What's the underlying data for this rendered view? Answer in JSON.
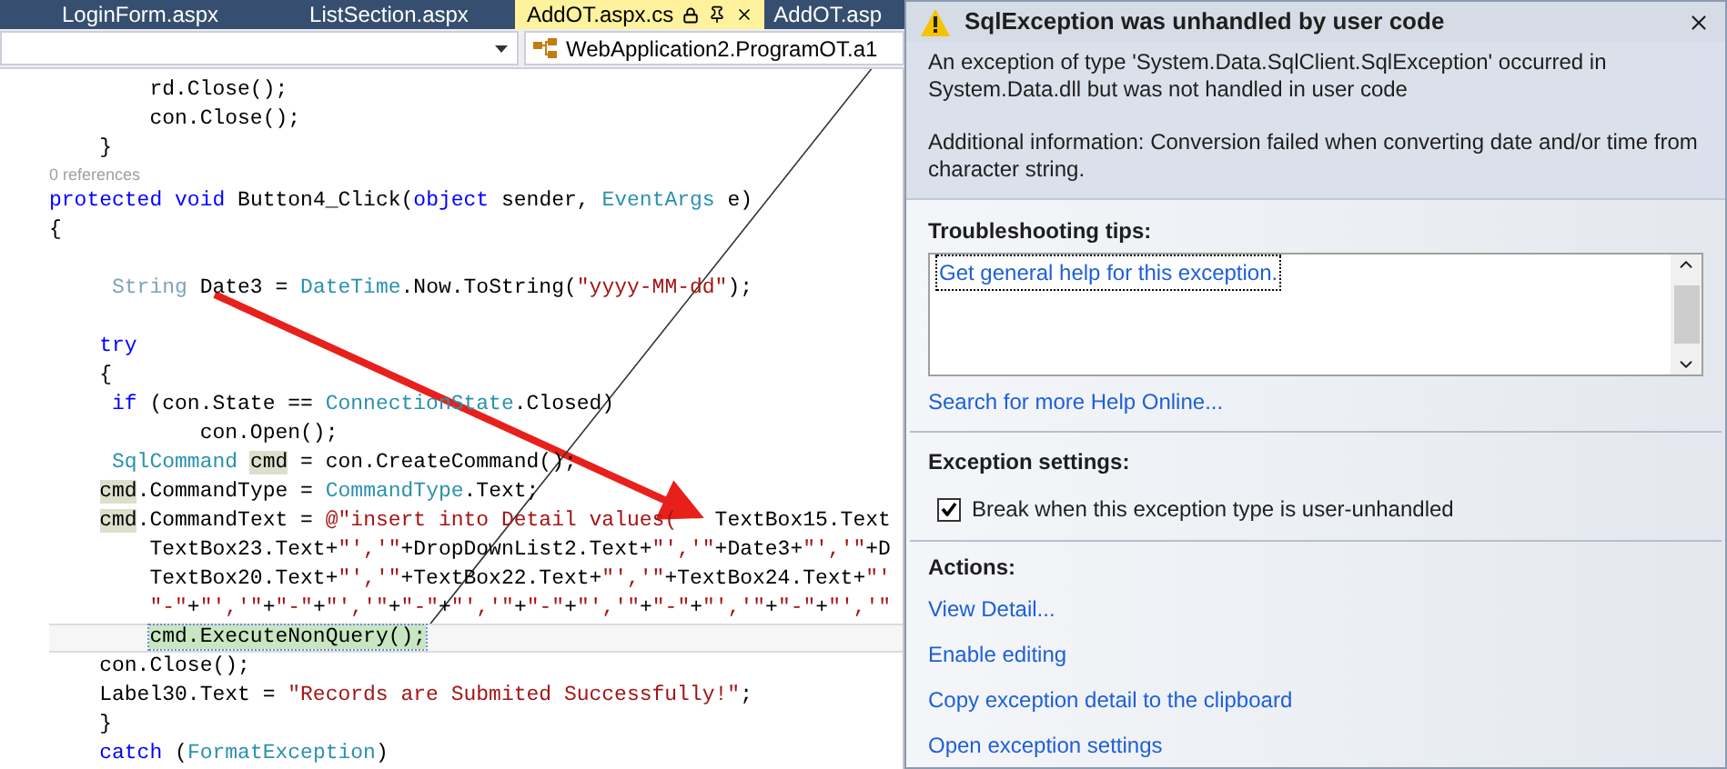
{
  "tabs": [
    {
      "label": "LoginForm.aspx",
      "selected": false
    },
    {
      "label": "ListSection.aspx",
      "selected": false
    },
    {
      "label": "AddOT.aspx.cs",
      "selected": true
    },
    {
      "label": "AddOT.asp",
      "selected": false
    }
  ],
  "nav_bar": {
    "class_dropdown": "WebApplication2.ProgramOT.a1"
  },
  "code_lines": [
    {
      "tokens": [
        {
          "kind": "plain",
          "text": "        rd.Close();"
        }
      ]
    },
    {
      "tokens": [
        {
          "kind": "plain",
          "text": "        con.Close();"
        }
      ]
    },
    {
      "tokens": [
        {
          "kind": "plain",
          "text": "    }"
        }
      ]
    },
    {
      "tokens": [
        {
          "kind": "ref",
          "text": "0 references"
        }
      ]
    },
    {
      "tokens": [
        {
          "kind": "kw",
          "text": "protected"
        },
        {
          "kind": "kw",
          "text": " void"
        },
        {
          "kind": "plain",
          "text": " Button4_Click("
        },
        {
          "kind": "kw",
          "text": "object"
        },
        {
          "kind": "plain",
          "text": " sender, "
        },
        {
          "kind": "type",
          "text": "EventArgs"
        },
        {
          "kind": "plain",
          "text": " e)"
        }
      ]
    },
    {
      "tokens": [
        {
          "kind": "plain",
          "text": "{"
        }
      ]
    },
    {
      "blank": true
    },
    {
      "tokens": [
        {
          "kind": "faded",
          "text": "     String"
        },
        {
          "kind": "plain",
          "text": " Date3 = "
        },
        {
          "kind": "type",
          "text": "DateTime"
        },
        {
          "kind": "plain",
          "text": ".Now.ToString("
        },
        {
          "kind": "str",
          "text": "\"yyyy-MM-dd\""
        },
        {
          "kind": "plain",
          "text": ");"
        }
      ]
    },
    {
      "blank": true
    },
    {
      "tokens": [
        {
          "kind": "kw",
          "text": "    try"
        }
      ]
    },
    {
      "tokens": [
        {
          "kind": "plain",
          "text": "    {"
        }
      ]
    },
    {
      "tokens": [
        {
          "kind": "kw",
          "text": "     if"
        },
        {
          "kind": "plain",
          "text": " (con.State == "
        },
        {
          "kind": "type",
          "text": "ConnectionState"
        },
        {
          "kind": "plain",
          "text": ".Closed)"
        }
      ]
    },
    {
      "tokens": [
        {
          "kind": "plain",
          "text": "            con.Open();"
        }
      ]
    },
    {
      "tokens": [
        {
          "kind": "type",
          "text": "     SqlCommand"
        },
        {
          "kind": "ref_highlight",
          "text": " cmd"
        },
        {
          "kind": "plain",
          "text": " = con.CreateCommand();"
        }
      ]
    },
    {
      "tokens": [
        {
          "kind": "ref_highlight",
          "text": "    cmd"
        },
        {
          "kind": "plain",
          "text": ".CommandType = "
        },
        {
          "kind": "type",
          "text": "CommandType"
        },
        {
          "kind": "plain",
          "text": ".Text;"
        }
      ]
    },
    {
      "tokens": [
        {
          "kind": "ref_highlight",
          "text": "    cmd"
        },
        {
          "kind": "plain",
          "text": ".CommandText = "
        },
        {
          "kind": "str",
          "text": "@\"insert into Detail values("
        },
        {
          "kind": "plain",
          "text": "   TextBox15.Text"
        }
      ]
    },
    {
      "tokens": [
        {
          "kind": "plain",
          "text": "        TextBox23.Text+"
        },
        {
          "kind": "str",
          "text": "\"','\""
        },
        {
          "kind": "plain",
          "text": "+DropDownList2.Text+"
        },
        {
          "kind": "str",
          "text": "\"','\""
        },
        {
          "kind": "plain",
          "text": "+Date3+"
        },
        {
          "kind": "str",
          "text": "\"','\""
        },
        {
          "kind": "plain",
          "text": "+D"
        }
      ]
    },
    {
      "tokens": [
        {
          "kind": "plain",
          "text": "        TextBox20.Text+"
        },
        {
          "kind": "str",
          "text": "\"','\""
        },
        {
          "kind": "plain",
          "text": "+TextBox22.Text+"
        },
        {
          "kind": "str",
          "text": "\"','\""
        },
        {
          "kind": "plain",
          "text": "+TextBox24.Text+"
        },
        {
          "kind": "str",
          "text": "\"'"
        }
      ]
    },
    {
      "tokens": [
        {
          "kind": "str",
          "text": "        \"-\""
        },
        {
          "kind": "plain",
          "text": "+"
        },
        {
          "kind": "str",
          "text": "\"','\""
        },
        {
          "kind": "plain",
          "text": "+"
        },
        {
          "kind": "str",
          "text": "\"-\""
        },
        {
          "kind": "plain",
          "text": "+"
        },
        {
          "kind": "str",
          "text": "\"','\""
        },
        {
          "kind": "plain",
          "text": "+"
        },
        {
          "kind": "str",
          "text": "\"-\""
        },
        {
          "kind": "plain",
          "text": "+"
        },
        {
          "kind": "str",
          "text": "\"','\""
        },
        {
          "kind": "plain",
          "text": "+"
        },
        {
          "kind": "str",
          "text": "\"-\""
        },
        {
          "kind": "plain",
          "text": "+"
        },
        {
          "kind": "str",
          "text": "\"','\""
        },
        {
          "kind": "plain",
          "text": "+"
        },
        {
          "kind": "str",
          "text": "\"-\""
        },
        {
          "kind": "plain",
          "text": "+"
        },
        {
          "kind": "str",
          "text": "\"','\""
        },
        {
          "kind": "plain",
          "text": "+"
        },
        {
          "kind": "str",
          "text": "\"-\""
        },
        {
          "kind": "plain",
          "text": "+"
        },
        {
          "kind": "str",
          "text": "\"','\""
        }
      ]
    },
    {
      "current": true,
      "tokens": [
        {
          "kind": "statement",
          "text": "        cmd.ExecuteNonQuery();"
        }
      ]
    },
    {
      "tokens": [
        {
          "kind": "plain",
          "text": "    con.Close();"
        }
      ]
    },
    {
      "tokens": [
        {
          "kind": "plain",
          "text": "    Label30.Text = "
        },
        {
          "kind": "str",
          "text": "\"Records are Submited Successfully!\""
        },
        {
          "kind": "plain",
          "text": ";"
        }
      ]
    },
    {
      "tokens": [
        {
          "kind": "plain",
          "text": "    }"
        }
      ]
    },
    {
      "tokens": [
        {
          "kind": "kw",
          "text": "    catch"
        },
        {
          "kind": "plain",
          "text": " ("
        },
        {
          "kind": "type",
          "text": "FormatException"
        },
        {
          "kind": "plain",
          "text": ")"
        }
      ]
    }
  ],
  "exception_dialog": {
    "title": "SqlException was unhandled by user code",
    "message": [
      "An exception of type 'System.Data.SqlClient.SqlException' occurred in System.Data.dll but was not handled in user code",
      "Additional information: Conversion failed when converting date and/or time from character string."
    ],
    "troubleshooting": {
      "heading": "Troubleshooting tips:",
      "tips": [
        "Get general help for this exception."
      ]
    },
    "help_link": "Search for more Help Online...",
    "exception_settings": {
      "heading": "Exception settings:",
      "checkbox": {
        "label": "Break when this exception type is user-unhandled",
        "checked": true
      }
    },
    "actions": {
      "heading": "Actions:",
      "links": [
        "View Detail...",
        "Enable editing",
        "Copy exception detail to the clipboard",
        "Open exception settings"
      ]
    }
  }
}
